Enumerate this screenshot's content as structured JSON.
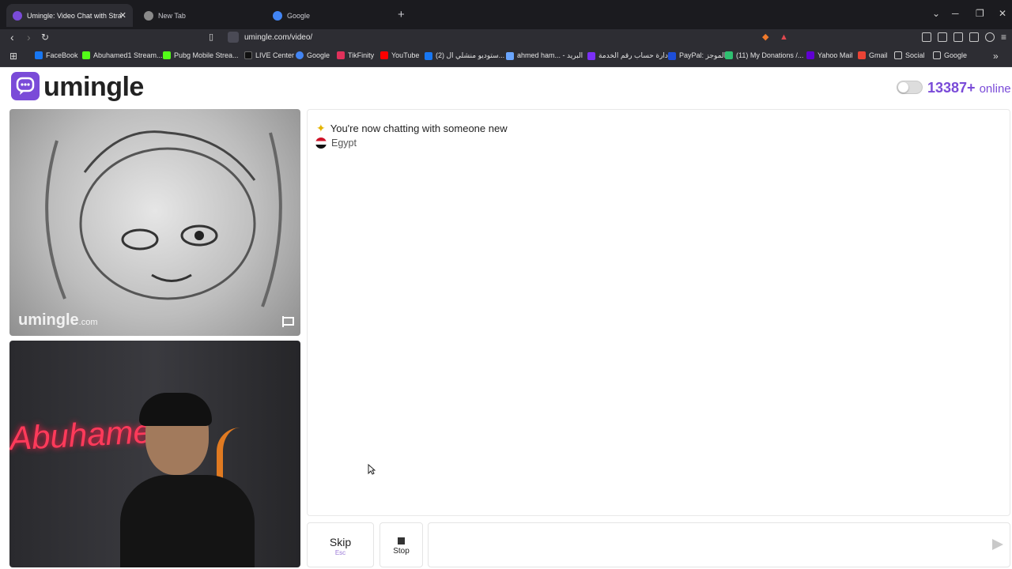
{
  "browser": {
    "tabs": [
      {
        "title": "Umingle: Video Chat with Stra",
        "active": true
      },
      {
        "title": "New Tab",
        "active": false
      },
      {
        "title": "Google",
        "active": false
      }
    ],
    "url": "umingle.com/video/",
    "bookmarks": [
      "FaceBook",
      "Abuhamed1 Stream...",
      "Pubg Mobile Strea...",
      "LIVE Center",
      "Google",
      "TikFinity",
      "YouTube",
      "(2) ستوديو منشلي ال...",
      "ahmed ham... - البريد",
      "إدارة حساب رقم الخدمة",
      "PayPal: الموجز",
      "(11) My Donations /...",
      "Yahoo Mail",
      "Gmail",
      "Social",
      "Google"
    ]
  },
  "site": {
    "logo": "umingle",
    "online_count": "13387+",
    "online_label": "online",
    "watermark": "umingle",
    "watermark_suffix": ".com",
    "neon_sign": "Abuhamed"
  },
  "chat": {
    "system_message": "You're now chatting with someone new",
    "country": "Egypt"
  },
  "controls": {
    "skip_label": "Skip",
    "skip_hint": "Esc",
    "stop_label": "Stop"
  },
  "colors": {
    "brand": "#7a4bd8",
    "browser_dark": "#1b1b1f",
    "toolbar": "#2d2d33"
  }
}
